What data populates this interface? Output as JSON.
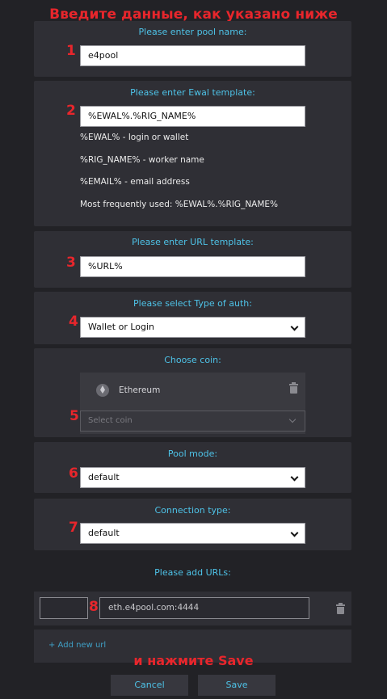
{
  "annotations": {
    "title": "Введите данные, как указано ниже",
    "bottom": "и нажмите Save",
    "steps": [
      "1",
      "2",
      "3",
      "4",
      "5",
      "6",
      "7",
      "8"
    ]
  },
  "pool_name": {
    "label": "Please enter pool name:",
    "value": "e4pool"
  },
  "ewal_template": {
    "label": "Please enter Ewal template:",
    "value": "%EWAL%.%RIG_NAME%",
    "help": [
      "%EWAL% - login or wallet",
      "%RIG_NAME% - worker name",
      "%EMAIL% - email address",
      "Most frequently used: %EWAL%.%RIG_NAME%"
    ]
  },
  "url_template": {
    "label": "Please enter URL template:",
    "value": "%URL%"
  },
  "auth_type": {
    "label": "Please select Type of auth:",
    "selected": "Wallet or Login"
  },
  "coin": {
    "label": "Choose coin:",
    "selected_coins": [
      "Ethereum"
    ],
    "icon": "ethereum-icon",
    "select_placeholder": "Select coin"
  },
  "pool_mode": {
    "label": "Pool mode:",
    "selected": "default"
  },
  "connection_type": {
    "label": "Connection type:",
    "selected": "default"
  },
  "urls": {
    "label": "Please add URLs:",
    "items": [
      {
        "port": "",
        "url": "eth.e4pool.com:4444"
      }
    ],
    "add_label": "+ Add new url"
  },
  "actions": {
    "cancel_label": "Cancel",
    "save_label": "Save"
  },
  "colors": {
    "background": "#222226",
    "panel": "#2f2f35",
    "accent": "#4ec3e8",
    "annotation": "#e8262c"
  }
}
